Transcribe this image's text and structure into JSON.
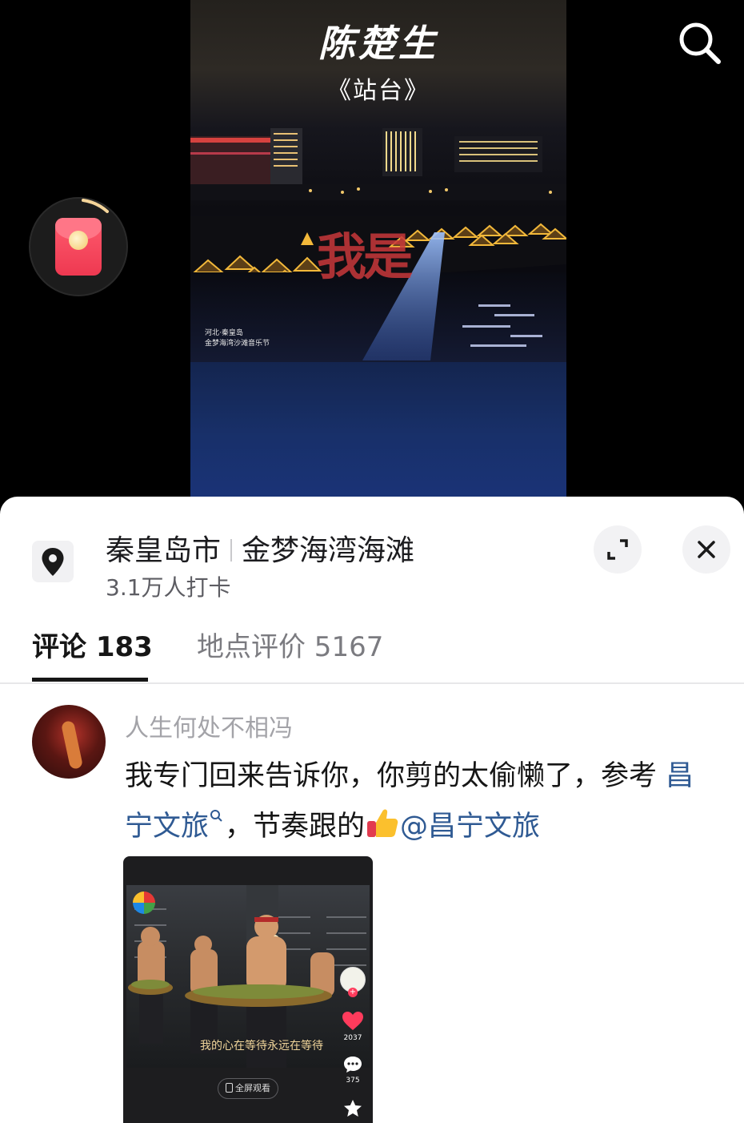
{
  "video": {
    "title": "陈楚生",
    "subtitle": "《站台》",
    "overlay_text": "我是",
    "caption_line1": "河北·秦皇岛",
    "caption_line2": "金梦海湾沙滩音乐节",
    "search_icon": "search-icon",
    "redpacket_icon": "red-packet-icon"
  },
  "location": {
    "city": "秦皇岛市",
    "place": "金梦海湾海滩",
    "checkins": "3.1万人打卡",
    "pin_icon": "location-pin-icon",
    "expand_icon": "expand-icon",
    "close_icon": "close-icon"
  },
  "tabs": [
    {
      "label": "评论 183",
      "active": true
    },
    {
      "label": "地点评价 5167",
      "active": false
    }
  ],
  "comment": {
    "username": "人生何处不相冯",
    "text_part1": "我专门回来告诉你，你剪的太偷懒了，参考",
    "link1": "昌宁文旅",
    "text_part2": "，节奏跟的",
    "mention": "@昌宁文旅",
    "attachment": {
      "caption": "我的心在等待永远在等待",
      "likes": "2037",
      "comments": "375",
      "fullscreen_label": "全屏观看"
    }
  },
  "colors": {
    "link": "#2f5a93",
    "sheet_bg": "#ffffff",
    "text_primary": "#161616",
    "text_secondary": "#a3a3a8",
    "red_packet": "#ee3951"
  }
}
